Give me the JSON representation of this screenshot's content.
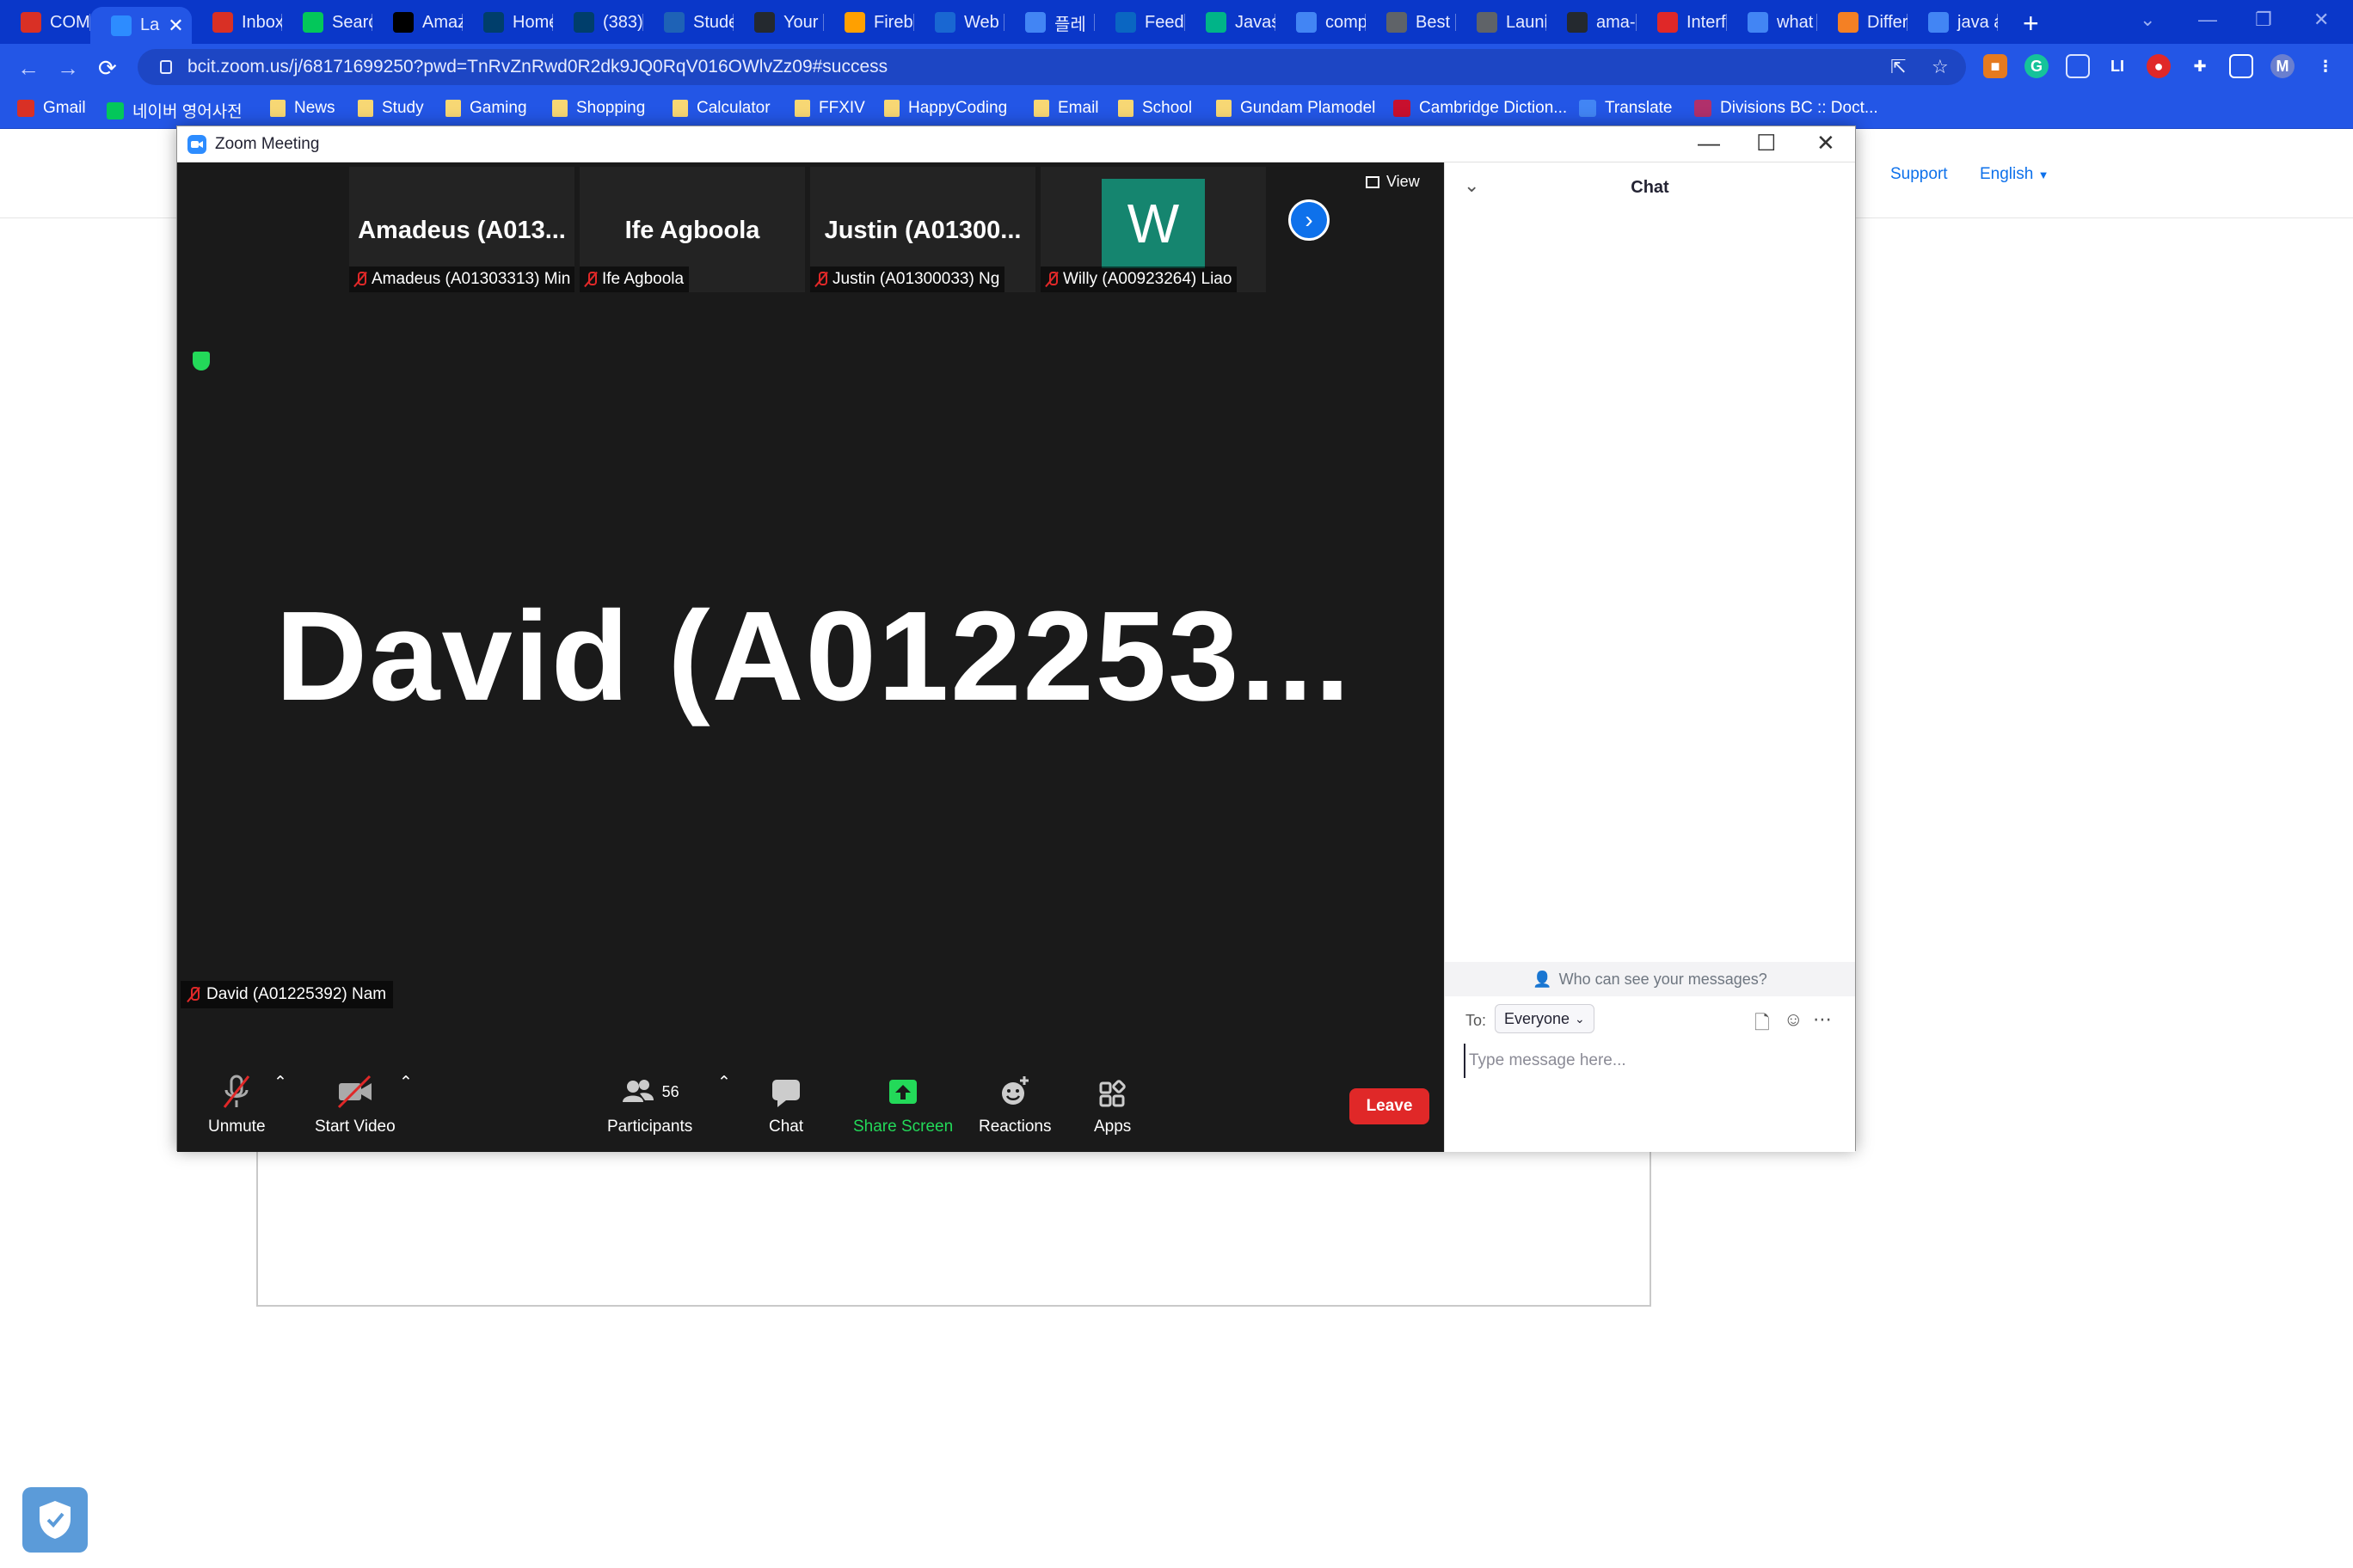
{
  "browser": {
    "tabs": [
      {
        "label": "COMI",
        "icon": "gmail-icon",
        "color": "#d93025"
      },
      {
        "label": "La",
        "icon": "zoom-icon",
        "color": "#2d8cff",
        "active": true
      },
      {
        "label": "Inbox",
        "icon": "gmail-icon",
        "color": "#d93025"
      },
      {
        "label": "Searc",
        "icon": "naver-icon",
        "color": "#03c75a"
      },
      {
        "label": "Amaz",
        "icon": "amazon-icon",
        "color": "#000000"
      },
      {
        "label": "Home",
        "icon": "bcit-icon",
        "color": "#003e6b"
      },
      {
        "label": "(383)",
        "icon": "bcit-icon",
        "color": "#003e6b"
      },
      {
        "label": "Stude",
        "icon": "web-icon",
        "color": "#1e62b6"
      },
      {
        "label": "Your",
        "icon": "github-icon",
        "color": "#24292f"
      },
      {
        "label": "Fireb",
        "icon": "firebase-icon",
        "color": "#ffa000"
      },
      {
        "label": "Web",
        "icon": "info-icon",
        "color": "#1967d2"
      },
      {
        "label": "플레",
        "icon": "web-icon",
        "color": "#4285f4"
      },
      {
        "label": "Feed",
        "icon": "linkedin-icon",
        "color": "#0a66c2"
      },
      {
        "label": "Javas",
        "icon": "v-icon",
        "color": "#00b488"
      },
      {
        "label": "comp",
        "icon": "google-icon",
        "color": "#4285f4"
      },
      {
        "label": "Best",
        "icon": "globe-icon",
        "color": "#5f6368"
      },
      {
        "label": "Launi",
        "icon": "globe-icon",
        "color": "#5f6368"
      },
      {
        "label": "ama-",
        "icon": "github-icon",
        "color": "#24292f"
      },
      {
        "label": "Interf",
        "icon": "pdf-icon",
        "color": "#e02828"
      },
      {
        "label": "what",
        "icon": "google-icon",
        "color": "#4285f4"
      },
      {
        "label": "Differ",
        "icon": "stack-icon",
        "color": "#f48024"
      },
      {
        "label": "java a",
        "icon": "google-icon",
        "color": "#4285f4"
      }
    ],
    "url": "bcit.zoom.us/j/68171699250?pwd=TnRvZnRwd0R2dk9JQ0RqV016OWlvZz09#success",
    "profile_initial": "M",
    "bookmarks": [
      {
        "label": "Gmail",
        "type": "gmail-icon"
      },
      {
        "label": "네이버 영어사전",
        "type": "naver-icon"
      },
      {
        "label": "News",
        "type": "folder-icon"
      },
      {
        "label": "Study",
        "type": "folder-icon"
      },
      {
        "label": "Gaming",
        "type": "folder-icon"
      },
      {
        "label": "Shopping",
        "type": "folder-icon"
      },
      {
        "label": "Calculator",
        "type": "folder-icon"
      },
      {
        "label": "FFXIV",
        "type": "folder-icon"
      },
      {
        "label": "HappyCoding",
        "type": "folder-icon"
      },
      {
        "label": "Email",
        "type": "folder-icon"
      },
      {
        "label": "School",
        "type": "folder-icon"
      },
      {
        "label": "Gundam Plamodel",
        "type": "folder-icon"
      },
      {
        "label": "Cambridge Diction...",
        "type": "cambridge-icon"
      },
      {
        "label": "Translate",
        "type": "translate-icon"
      },
      {
        "label": "Divisions BC :: Doct...",
        "type": "divisions-icon"
      }
    ]
  },
  "page": {
    "support_link": "Support",
    "language": "English"
  },
  "zoom": {
    "window_title": "Zoom Meeting",
    "view_label": "View",
    "thumbnails": [
      {
        "display": "Amadeus  (A013...",
        "label": "Amadeus (A01303313) Min"
      },
      {
        "display": "Ife Agboola",
        "label": "Ife Agboola"
      },
      {
        "display": "Justin  (A01300...",
        "label": "Justin (A01300033) Ng"
      },
      {
        "display": "W",
        "label": "Willy (A00923264) Liao",
        "avatar_color": "#15856f"
      }
    ],
    "active_speaker": {
      "display": "David  (A012253...",
      "label": "David (A01225392) Nam"
    },
    "toolbar": {
      "unmute": "Unmute",
      "start_video": "Start Video",
      "participants": "Participants",
      "participants_count": "56",
      "chat": "Chat",
      "share_screen": "Share Screen",
      "reactions": "Reactions",
      "apps": "Apps",
      "leave": "Leave"
    },
    "chat": {
      "title": "Chat",
      "who_can_see": "Who can see your messages?",
      "to_label": "To:",
      "recipient": "Everyone",
      "placeholder": "Type message here..."
    },
    "colors": {
      "accent": "#0e71eb",
      "share_green": "#23d959",
      "leave_red": "#e02828",
      "muted_red": "#e02828"
    }
  }
}
